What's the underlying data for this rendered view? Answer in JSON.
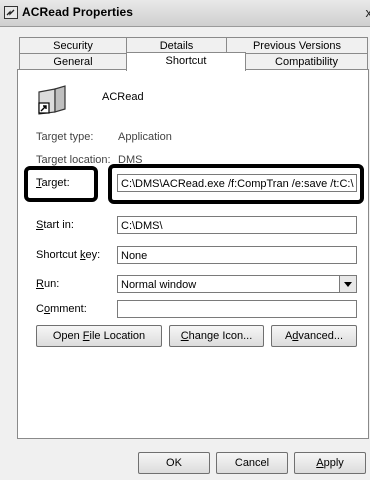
{
  "window": {
    "title": "ACRead Properties",
    "close_glyph": "x"
  },
  "tabs": {
    "row1": [
      "Security",
      "Details",
      "Previous Versions"
    ],
    "row2": [
      "General",
      "Shortcut",
      "Compatibility"
    ],
    "active": "Shortcut"
  },
  "app": {
    "name": "ACRead",
    "icon": "shortcut-app-icon"
  },
  "fields": {
    "target_type_label": "Target type:",
    "target_type_value": "Application",
    "target_location_label": "Target location:",
    "target_location_value": "DMS",
    "target_label": "Target:",
    "target_value": "C:\\DMS\\ACRead.exe /f:CompTran /e:save /t:C:\\",
    "start_in_label": "Start in:",
    "start_in_value": "C:\\DMS\\",
    "shortcut_key_label": "Shortcut key:",
    "shortcut_key_value": "None",
    "run_label": "Run:",
    "run_value": "Normal window",
    "comment_label": "Comment:",
    "comment_value": ""
  },
  "buttons": {
    "open_file_location": "Open File Location",
    "change_icon": "Change Icon...",
    "advanced": "Advanced...",
    "ok": "OK",
    "cancel": "Cancel",
    "apply": "Apply"
  },
  "colors": {
    "highlight": "#000000",
    "dialog_bg": "#f0f0f0"
  }
}
